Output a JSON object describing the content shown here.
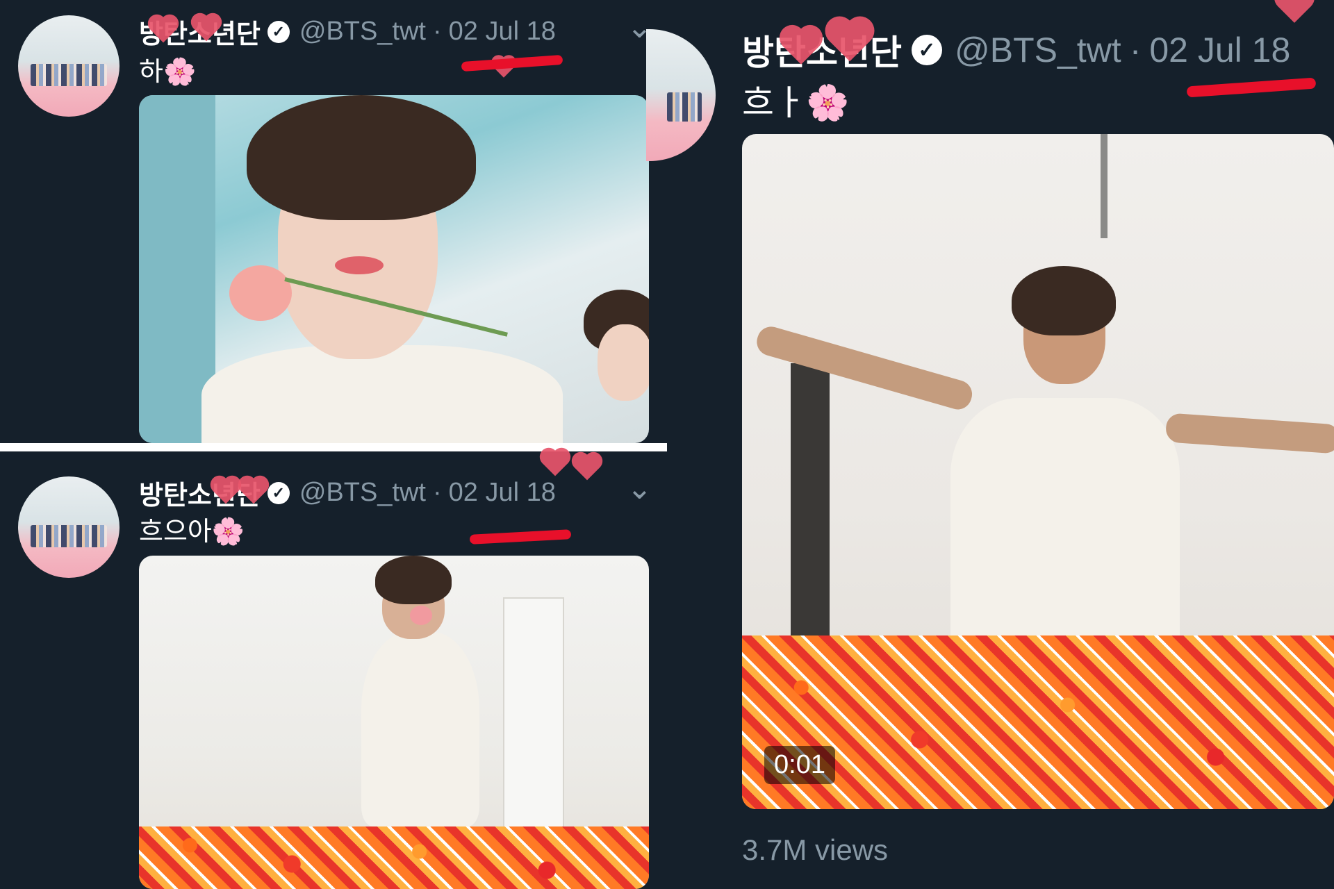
{
  "tweets": [
    {
      "name": "방탄소년단",
      "handle": "@BTS_twt",
      "date": "02 Jul 18",
      "text": "하🌸",
      "caret": "⌄"
    },
    {
      "name": "방탄소년단",
      "handle": "@BTS_twt",
      "date": "02 Jul 18",
      "text": "흐으아🌸",
      "caret": "⌄"
    },
    {
      "name": "방탄소년단",
      "handle": "@BTS_twt",
      "date": "02 Jul 18",
      "text": "흐ㅏ🌸",
      "video_duration": "0:01",
      "views": "3.7M views"
    }
  ],
  "colors": {
    "background": "#15202b",
    "handle": "#8899a6",
    "annotation_red": "#e8102a",
    "heart_pink": "#e8556b"
  },
  "icons": {
    "verified": "verified-badge-icon",
    "caret": "chevron-down-icon",
    "flower": "cherry-blossom-icon"
  }
}
